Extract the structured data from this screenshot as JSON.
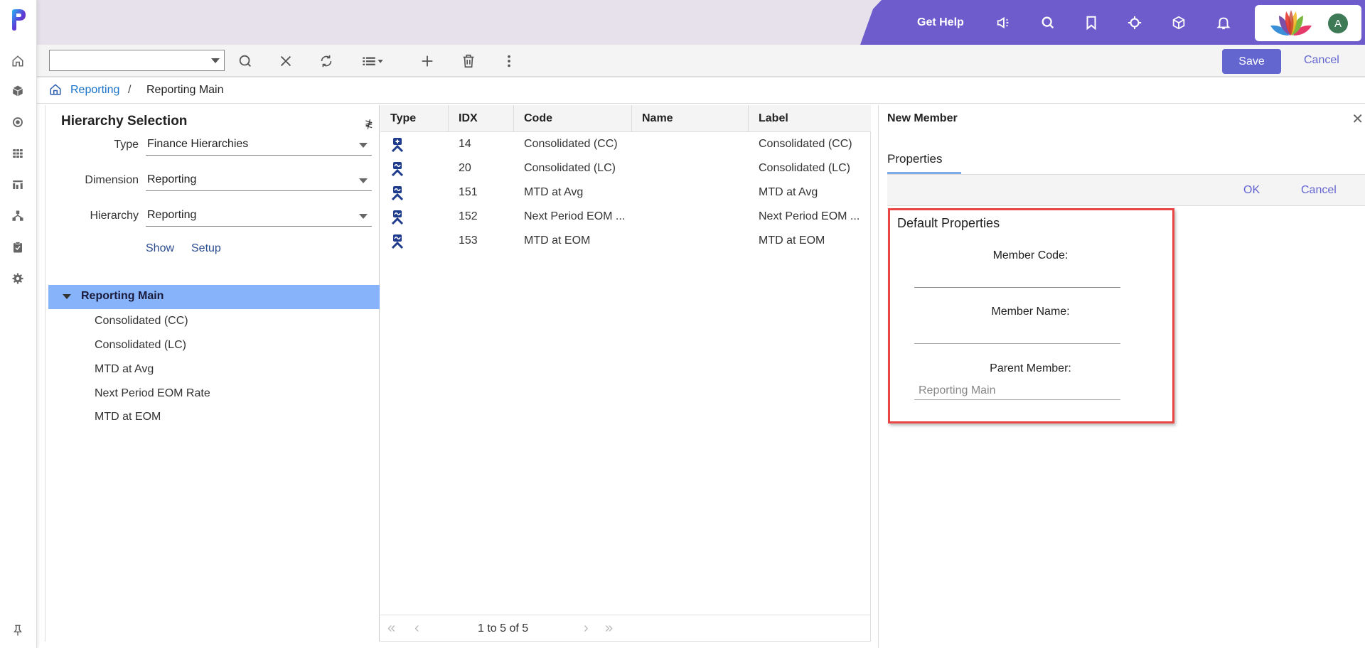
{
  "header": {
    "get_help": "Get Help",
    "icons": [
      "announcement-icon",
      "search-icon",
      "bookmark-icon",
      "target-icon",
      "cube-icon",
      "bell-icon"
    ],
    "avatar_initial": "A",
    "brand_color": "#6e5ccc"
  },
  "rail": {
    "items": [
      "home-icon",
      "cube-icon",
      "target-icon",
      "grid-icon",
      "report-icon",
      "hierarchy-icon",
      "clipboard-icon",
      "settings-icon"
    ],
    "pin": "pin-icon"
  },
  "toolbar": {
    "select_value": "",
    "save_label": "Save",
    "cancel_label": "Cancel"
  },
  "breadcrumb": {
    "items": [
      "Reporting",
      "Reporting Main"
    ],
    "separator": "/"
  },
  "left_panel": {
    "title": "Hierarchy Selection",
    "fields": [
      {
        "label": "Type",
        "value": "Finance Hierarchies"
      },
      {
        "label": "Dimension",
        "value": "Reporting"
      },
      {
        "label": "Hierarchy",
        "value": "Reporting"
      }
    ],
    "links": [
      "Show",
      "Setup"
    ],
    "tree": {
      "root": "Reporting Main",
      "children": [
        "Consolidated (CC)",
        "Consolidated (LC)",
        "MTD at Avg",
        "Next Period EOM Rate",
        "MTD at EOM"
      ]
    }
  },
  "grid": {
    "columns": [
      "Type",
      "IDX",
      "Code",
      "Name",
      "Label"
    ],
    "rows": [
      {
        "type": "consolidation-plus-icon",
        "idx": "14",
        "code": "Consolidated (CC)",
        "name": "",
        "label": "Consolidated (CC)"
      },
      {
        "type": "consolidation-wave-icon",
        "idx": "20",
        "code": "Consolidated (LC)",
        "name": "",
        "label": "Consolidated (LC)"
      },
      {
        "type": "consolidation-wave-icon",
        "idx": "151",
        "code": "MTD at Avg",
        "name": "",
        "label": "MTD at Avg"
      },
      {
        "type": "consolidation-wave-icon",
        "idx": "152",
        "code": "Next Period EOM ...",
        "name": "",
        "label": "Next Period EOM ..."
      },
      {
        "type": "consolidation-wave-icon",
        "idx": "153",
        "code": "MTD at EOM",
        "name": "",
        "label": "MTD at EOM"
      }
    ],
    "pager": {
      "text": "1 to 5 of 5",
      "first": "«",
      "prev": "‹",
      "next": "›",
      "last": "»"
    }
  },
  "right_panel": {
    "title": "New Member",
    "close": "✕",
    "tab": "Properties",
    "ok_label": "OK",
    "cancel_label": "Cancel",
    "section_title": "Default Properties",
    "fields": [
      {
        "label": "Member Code:",
        "value": ""
      },
      {
        "label": "Member Name:",
        "value": ""
      },
      {
        "label": "Parent Member:",
        "value": "Reporting Main"
      }
    ],
    "highlight_color": "#e84545"
  }
}
